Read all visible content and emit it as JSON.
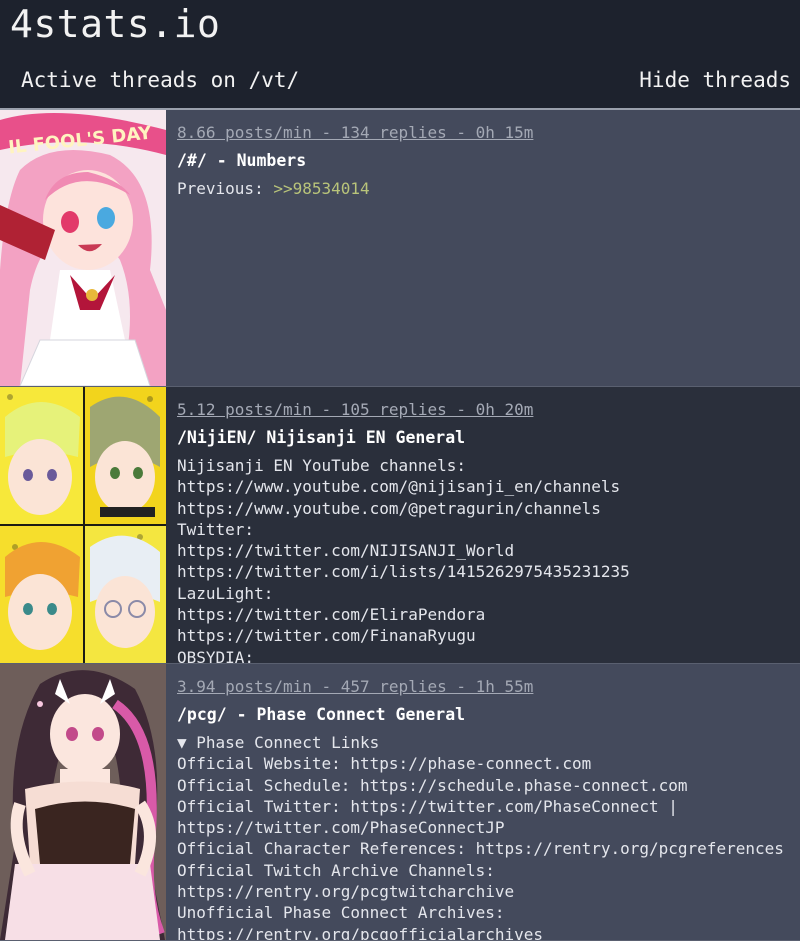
{
  "header": {
    "site_title": "4stats.io",
    "subtitle": "Active threads on /vt/",
    "hide_label": "Hide threads"
  },
  "threads": [
    {
      "stats": "8.66 posts/min - 134 replies - 0h 15m",
      "title": "/#/ - Numbers",
      "previous_label": "Previous: ",
      "previous_link": ">>98534014"
    },
    {
      "stats": "5.12 posts/min - 105 replies - 0h 20m",
      "title": "/NijiEN/ Nijisanji EN General",
      "lines": [
        "Nijisanji EN YouTube channels:",
        "https://www.youtube.com/@nijisanji_en/channels",
        "https://www.youtube.com/@petragurin/channels",
        "Twitter:",
        "https://twitter.com/NIJISANJI_World",
        "https://twitter.com/i/lists/1415262975435231235",
        "LazuLight:",
        "https://twitter.com/EliraPendora",
        "https://twitter.com/FinanaRyugu",
        "OBSYDIA:"
      ]
    },
    {
      "stats": "3.94 posts/min - 457 replies - 1h 55m",
      "title": "/pcg/ - Phase Connect General",
      "lines": [
        "▼ Phase Connect Links",
        "Official Website: https://phase-connect.com",
        "Official Schedule: https://schedule.phase-connect.com",
        "Official Twitter: https://twitter.com/PhaseConnect |",
        "https://twitter.com/PhaseConnectJP",
        "Official Character References: https://rentry.org/pcgreferences",
        "Official Twitch Archive Channels:",
        "https://rentry.org/pcgtwitcharchive",
        "Unofficial Phase Connect Archives:",
        "https://rentry.org/pcgofficialarchives"
      ]
    }
  ],
  "colors": {
    "header_bg": "#1d222d",
    "row_light": "#444a5c",
    "row_dark": "#2a2f3b",
    "quote_link": "#b9c47a"
  }
}
